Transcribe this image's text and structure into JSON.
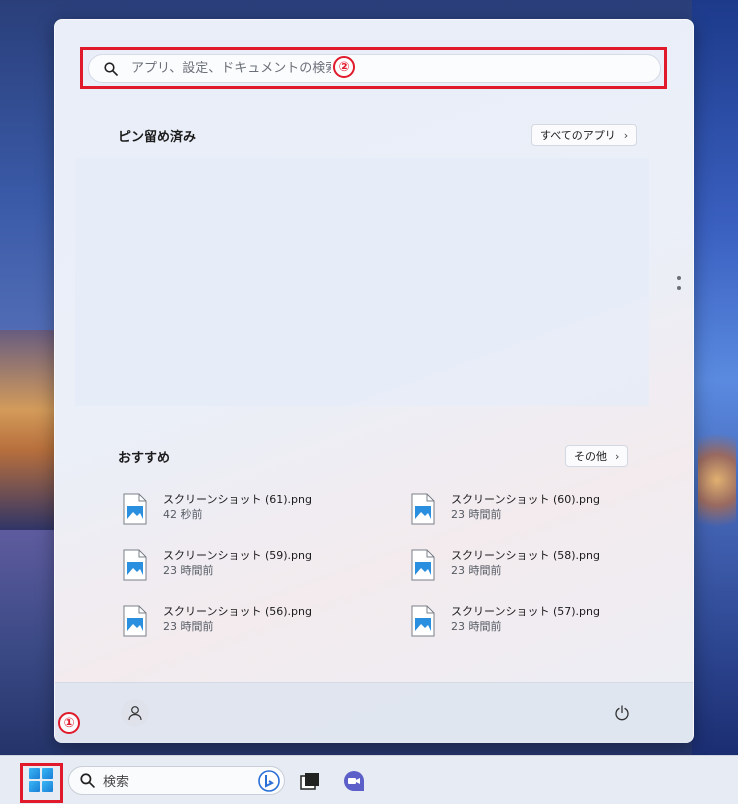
{
  "start_menu": {
    "search": {
      "placeholder": "アプリ、設定、ドキュメントの検索"
    },
    "annotations": {
      "search_badge": "②",
      "start_badge": "①"
    },
    "pinned": {
      "title": "ピン留め済み",
      "all_apps_label": "すべてのアプリ"
    },
    "recommended": {
      "title": "おすすめ",
      "more_label": "その他",
      "items": [
        {
          "name": "スクリーンショット (61).png",
          "time": "42 秒前"
        },
        {
          "name": "スクリーンショット (60).png",
          "time": "23 時間前"
        },
        {
          "name": "スクリーンショット (59).png",
          "time": "23 時間前"
        },
        {
          "name": "スクリーンショット (58).png",
          "time": "23 時間前"
        },
        {
          "name": "スクリーンショット (56).png",
          "time": "23 時間前"
        },
        {
          "name": "スクリーンショット (57).png",
          "time": "23 時間前"
        }
      ]
    },
    "footer": {
      "user_icon": "user-icon",
      "power_icon": "power-icon"
    }
  },
  "taskbar": {
    "search_label": "検索",
    "icons": [
      "windows-start-icon",
      "search-icon",
      "bing-icon",
      "task-view-icon",
      "teams-meet-icon"
    ]
  },
  "colors": {
    "highlight": "#e01a2b",
    "windows_blue": "#1a7fd6"
  }
}
